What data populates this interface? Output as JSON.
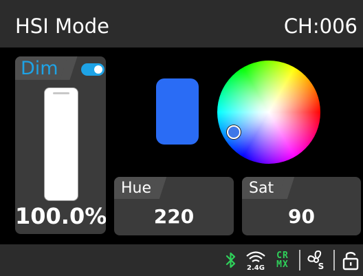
{
  "header": {
    "title": "HSI Mode",
    "channel": "CH:006"
  },
  "dim": {
    "label": "Dim",
    "enabled": true,
    "level_percent": 100.0,
    "value_text": "100.0%"
  },
  "color": {
    "swatch_color": "#2a6cf5",
    "accent": "#1ea3e6"
  },
  "hue": {
    "label": "Hue",
    "value": "220"
  },
  "sat": {
    "label": "Sat",
    "value": "90"
  },
  "status": {
    "icons": [
      "bluetooth-icon",
      "wireless-2.4g-icon",
      "crmx-icon",
      "fan-icon",
      "lock-icon"
    ],
    "wireless_label": "2.4G",
    "crmx_top": "CR",
    "crmx_bottom": "MX",
    "fan_mode": "S"
  }
}
